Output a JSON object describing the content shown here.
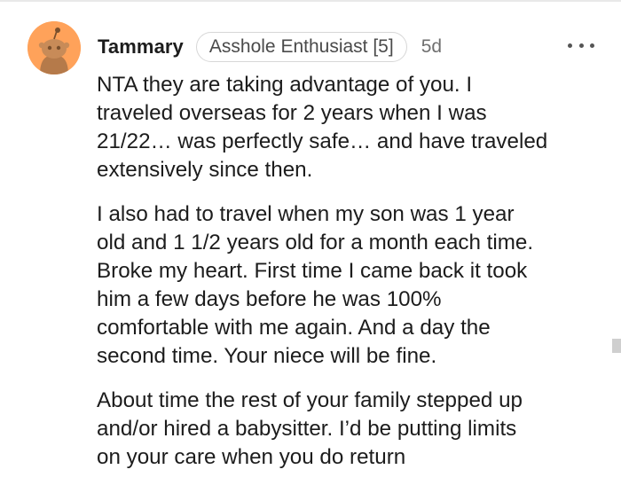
{
  "comment": {
    "username": "Tammary",
    "flair": "Asshole Enthusiast [5]",
    "age": "5d",
    "paragraphs": [
      {
        "lines": [
          "NTA they are taking advantage of you. I",
          "traveled overseas for 2 years when I was",
          "21/22… was perfectly safe… and have traveled",
          "extensively since then."
        ]
      },
      {
        "lines": [
          "I also had to travel when my son was 1 year",
          "old and 1 1/2 years old for a month each time.",
          "Broke my heart. First time I came back it took",
          "him a few days before he was 100%",
          "comfortable with me again. And a day the",
          "second time. Your niece will be fine."
        ]
      },
      {
        "lines": [
          "About time the rest of your family stepped up",
          "and/or hired a babysitter. I’d be putting limits",
          "on your care when you do return"
        ]
      }
    ]
  },
  "colors": {
    "avatar_bg": "#ffa25a",
    "text": "#1c1c1c",
    "meta": "#6f6f6f"
  },
  "icons": {
    "avatar": "snoo-avatar-icon",
    "more": "more-options-icon"
  }
}
